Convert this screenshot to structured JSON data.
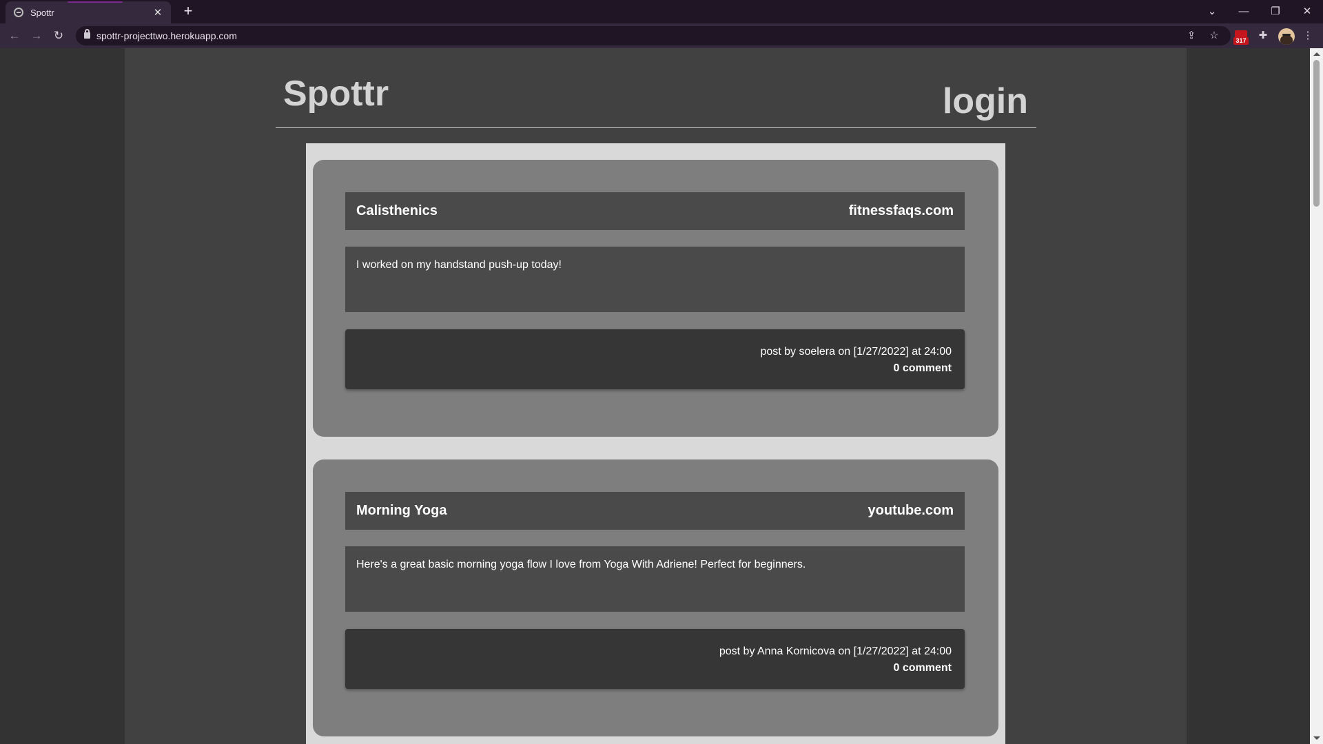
{
  "browser": {
    "tab_title": "Spottr",
    "url": "spottr-projecttwo.herokuapp.com",
    "extension_badge": "317"
  },
  "site": {
    "logo": "Spottr",
    "login_label": "login"
  },
  "posts": [
    {
      "title": "Calisthenics",
      "link": "fitnessfaqs.com",
      "body": "I worked on my handstand push-up today!",
      "meta": "post by soelera on [1/27/2022] at 24:00",
      "comments": "0 comment"
    },
    {
      "title": "Morning Yoga",
      "link": "youtube.com",
      "body": "Here's a great basic morning yoga flow I love from Yoga With Adriene! Perfect for beginners.",
      "meta": "post by Anna Kornicova on [1/27/2022] at 24:00",
      "comments": "0 comment"
    }
  ]
}
